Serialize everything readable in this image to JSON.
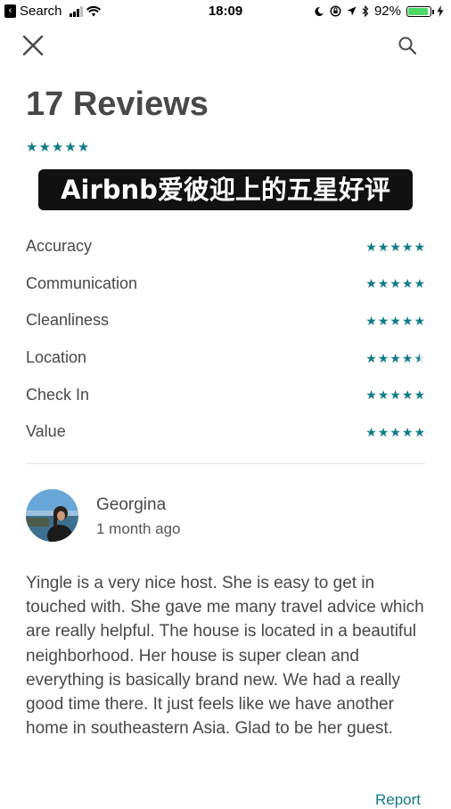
{
  "status_bar": {
    "back_app": "Search",
    "time": "18:09",
    "battery_percent": "92%",
    "battery_level": 0.92
  },
  "header": {
    "close_icon": "close-icon",
    "search_icon": "search-icon"
  },
  "title": "17 Reviews",
  "overall_rating": 5,
  "banner_text": "Airbnb爱彼迎上的五星好评",
  "ratings": [
    {
      "label": "Accuracy",
      "stars": 5
    },
    {
      "label": "Communication",
      "stars": 5
    },
    {
      "label": "Cleanliness",
      "stars": 5
    },
    {
      "label": "Location",
      "stars": 4.5
    },
    {
      "label": "Check In",
      "stars": 5
    },
    {
      "label": "Value",
      "stars": 5
    }
  ],
  "review": {
    "name": "Georgina",
    "date": "1 month ago",
    "text": "Yingle is a very nice host. She is easy to get in touched with. She gave me many travel advice which are really helpful. The house is located in a beautiful neighborhood. Her house is super clean and everything is basically brand new. We had a really good time there. It just feels like we have another home in southeastern Asia. Glad to be her guest.",
    "report_label": "Report"
  },
  "colors": {
    "accent": "#0e7c86",
    "text": "#484848",
    "battery": "#4cd964"
  }
}
